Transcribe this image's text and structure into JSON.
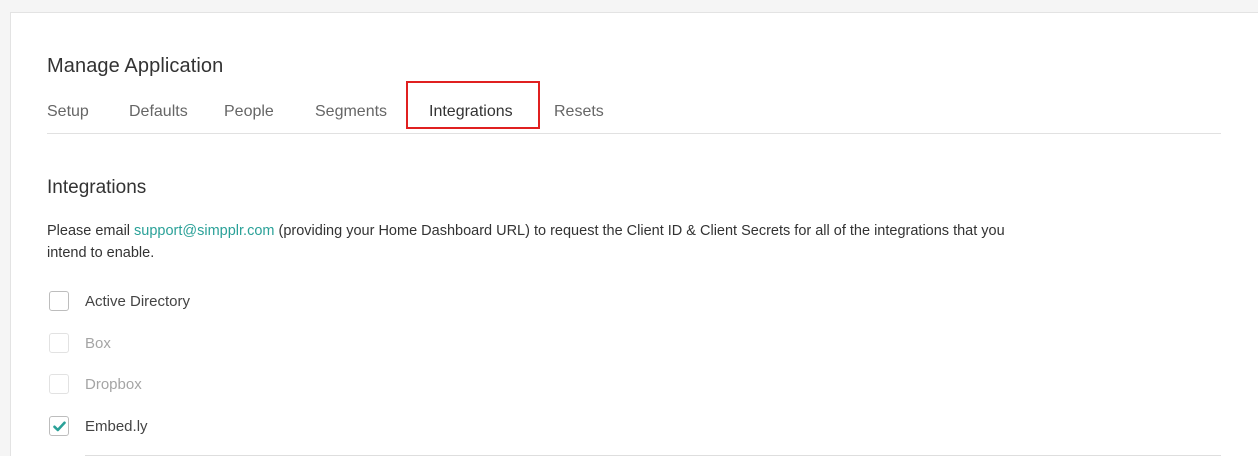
{
  "header": {
    "title": "Manage Application"
  },
  "tabs": [
    {
      "label": "Setup",
      "active": false
    },
    {
      "label": "Defaults",
      "active": false
    },
    {
      "label": "People",
      "active": false
    },
    {
      "label": "Segments",
      "active": false
    },
    {
      "label": "Integrations",
      "active": true
    },
    {
      "label": "Resets",
      "active": false
    }
  ],
  "section": {
    "title": "Integrations",
    "description_before": "Please email ",
    "support_email": "support@simpplr.com",
    "description_after": " (providing your Home Dashboard URL) to request the Client ID & Client Secrets for all of the integrations that you intend to enable."
  },
  "integrations": [
    {
      "label": "Active Directory",
      "checked": false,
      "disabled": false
    },
    {
      "label": "Box",
      "checked": false,
      "disabled": true
    },
    {
      "label": "Dropbox",
      "checked": false,
      "disabled": true
    },
    {
      "label": "Embed.ly",
      "checked": true,
      "disabled": false
    }
  ],
  "colors": {
    "accent": "#2aa198",
    "highlight_box": "#e02020"
  },
  "icons": {
    "checkmark": "check-icon"
  }
}
